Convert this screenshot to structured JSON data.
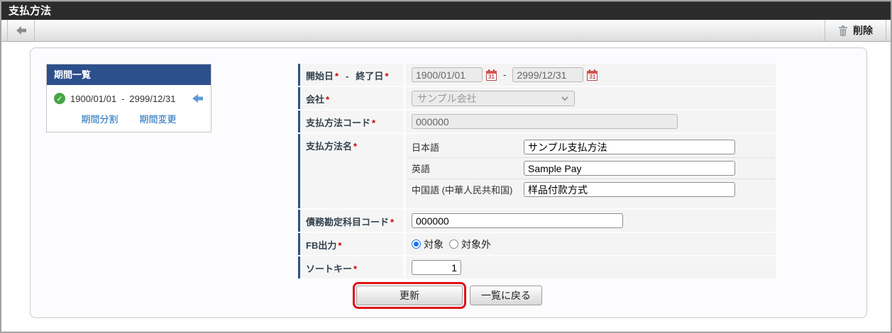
{
  "title_bar": {
    "title": "支払方法"
  },
  "toolbar": {
    "delete_label": "削除"
  },
  "icons": {
    "check": "✓"
  },
  "period_panel": {
    "header": "期間一覧",
    "start_date": "1900/01/01",
    "separator": "-",
    "end_date": "2999/12/31",
    "links": {
      "split": "期間分割",
      "change": "期間変更"
    }
  },
  "form": {
    "required_mark": "*",
    "date_row": {
      "label_start": "開始日",
      "label_separator": "-",
      "label_end": "終了日",
      "start_value": "1900/01/01",
      "value_separator": "-",
      "end_value": "2999/12/31",
      "calendar_day": "31"
    },
    "company": {
      "label": "会社",
      "value": "サンプル会社"
    },
    "code": {
      "label": "支払方法コード",
      "value": "000000"
    },
    "name": {
      "label": "支払方法名",
      "rows": [
        {
          "lang": "日本語",
          "value": "サンプル支払方法"
        },
        {
          "lang": "英語",
          "value": "Sample Pay"
        },
        {
          "lang": "中国語 (中華人民共和国)",
          "value": "样品付款方式"
        }
      ]
    },
    "account_code": {
      "label": "債務勘定科目コード",
      "value": "000000"
    },
    "fb_output": {
      "label": "FB出力",
      "options": [
        {
          "label": "対象",
          "selected": true
        },
        {
          "label": "対象外",
          "selected": false
        }
      ]
    },
    "sort_key": {
      "label": "ソートキー",
      "value": "1"
    }
  },
  "actions": {
    "update": "更新",
    "back": "一覧に戻る"
  },
  "colors": {
    "accent_navy": "#2d4f8c",
    "link_blue": "#1a6bb8",
    "required_red": "#cc0000",
    "highlight_red": "#e01414",
    "radio_blue": "#1a73e8",
    "check_green": "#46a546",
    "title_bg": "#2b2b2b"
  }
}
